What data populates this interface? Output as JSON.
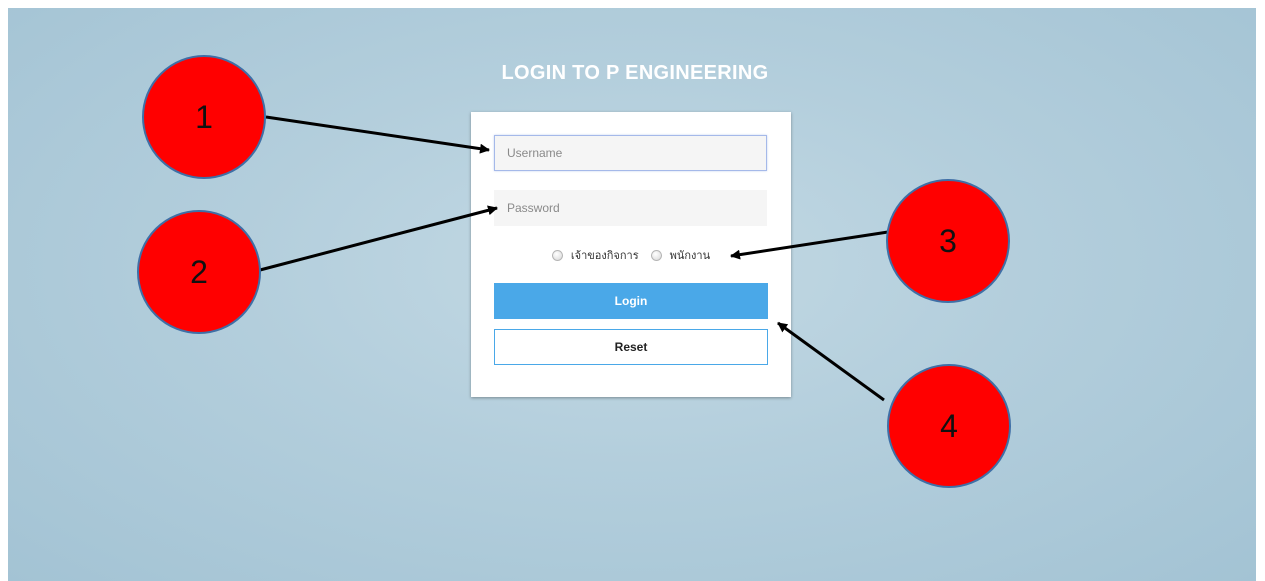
{
  "page": {
    "title": "LOGIN TO P ENGINEERING"
  },
  "login_form": {
    "username": {
      "value": "",
      "placeholder": "Username"
    },
    "password": {
      "value": "",
      "placeholder": "Password"
    },
    "roles": [
      {
        "label": "เจ้าของกิจการ",
        "selected": false
      },
      {
        "label": "พนักงาน",
        "selected": false
      }
    ],
    "login_label": "Login",
    "reset_label": "Reset"
  },
  "annotations": {
    "marker_color": "#ff0000",
    "markers": [
      {
        "label": "1"
      },
      {
        "label": "2"
      },
      {
        "label": "3"
      },
      {
        "label": "4"
      }
    ]
  },
  "colors": {
    "background": "#b3cedc",
    "accent": "#4aa8e8",
    "marker": "#ff0000"
  }
}
